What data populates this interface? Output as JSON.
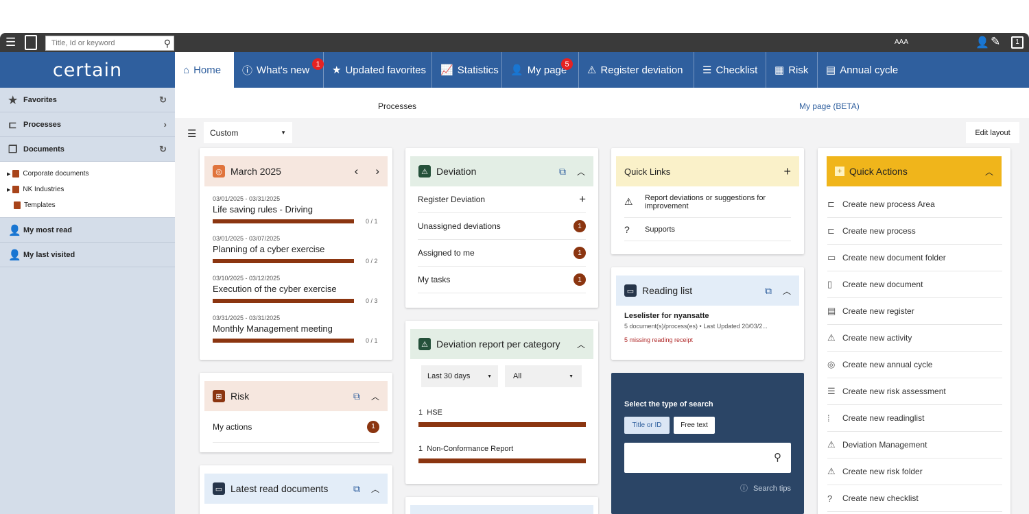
{
  "search": {
    "placeholder": "Title, Id or keyword"
  },
  "brand": {
    "logo": "certain"
  },
  "topbar": {
    "font_size_label": "AAA"
  },
  "nav": [
    {
      "label": "Home",
      "icon": "home-icon"
    },
    {
      "label": "What's new",
      "badge": "1",
      "icon": "info-icon"
    },
    {
      "label": "Updated favorites",
      "icon": "star-icon"
    },
    {
      "label": "Statistics",
      "icon": "chart-icon"
    },
    {
      "label": "My page",
      "badge": "5",
      "icon": "user-icon"
    },
    {
      "label": "Register deviation",
      "icon": "warning-icon"
    },
    {
      "label": "Checklist",
      "icon": "list-icon"
    },
    {
      "label": "Risk",
      "icon": "grid-icon"
    },
    {
      "label": "Annual cycle",
      "icon": "calendar-icon"
    }
  ],
  "sidebar": {
    "favorites": "Favorites",
    "processes": "Processes",
    "documents": "Documents",
    "tree": [
      "Corporate documents",
      "NK Industries",
      "Templates"
    ],
    "most_read": "My most read",
    "last_visited": "My last visited"
  },
  "subtabs": {
    "processes": "Processes",
    "mypage": "My page (BETA)"
  },
  "filter": {
    "selected": "Custom",
    "edit_layout": "Edit layout"
  },
  "calendar": {
    "title": "March 2025",
    "events": [
      {
        "dates": "03/01/2025 - 03/31/2025",
        "title": "Life saving rules - Driving",
        "progress": "0 / 1"
      },
      {
        "dates": "03/01/2025 - 03/07/2025",
        "title": "Planning of a cyber exercise",
        "progress": "0 / 2"
      },
      {
        "dates": "03/10/2025 - 03/12/2025",
        "title": "Execution of the cyber exercise",
        "progress": "0 / 3"
      },
      {
        "dates": "03/31/2025 - 03/31/2025",
        "title": "Monthly Management meeting",
        "progress": "0 / 1"
      }
    ]
  },
  "risk": {
    "title": "Risk",
    "my_actions": "My actions",
    "count": "1"
  },
  "latest": {
    "title": "Latest read documents"
  },
  "deviation": {
    "title": "Deviation",
    "rows": [
      {
        "label": "Register Deviation"
      },
      {
        "label": "Unassigned deviations",
        "count": "1"
      },
      {
        "label": "Assigned to me",
        "count": "1"
      },
      {
        "label": "My tasks",
        "count": "1"
      }
    ]
  },
  "devreport": {
    "title": "Deviation report per category",
    "period": "Last 30 days",
    "filter": "All",
    "items": [
      {
        "count": "1",
        "label": "HSE"
      },
      {
        "count": "1",
        "label": "Non-Conformance Report"
      }
    ]
  },
  "quicklinks": {
    "title": "Quick Links",
    "items": [
      "Report deviations or suggestions for improvement",
      "Supports"
    ]
  },
  "reading": {
    "title": "Reading list",
    "item_title": "Leselister for nyansatte",
    "item_meta": "5 document(s)/process(es) • Last Updated 20/03/2...",
    "missing": "5 missing reading receipt"
  },
  "searchbox": {
    "title": "Select the type of search",
    "opt1": "Title or ID",
    "opt2": "Free text",
    "tips": "Search tips"
  },
  "quickactions": {
    "title": "Quick Actions",
    "items": [
      "Create new process Area",
      "Create new process",
      "Create new document folder",
      "Create new document",
      "Create new register",
      "Create new activity",
      "Create new annual cycle",
      "Create new risk assessment",
      "Create new readinglist",
      "Deviation Management",
      "Create new risk folder",
      "Create new checklist"
    ]
  },
  "colors": {
    "nav": "#2f5f9e",
    "accent": "#8b3510",
    "quick_actions": "#f0b51b",
    "search_panel": "#2b4566"
  }
}
